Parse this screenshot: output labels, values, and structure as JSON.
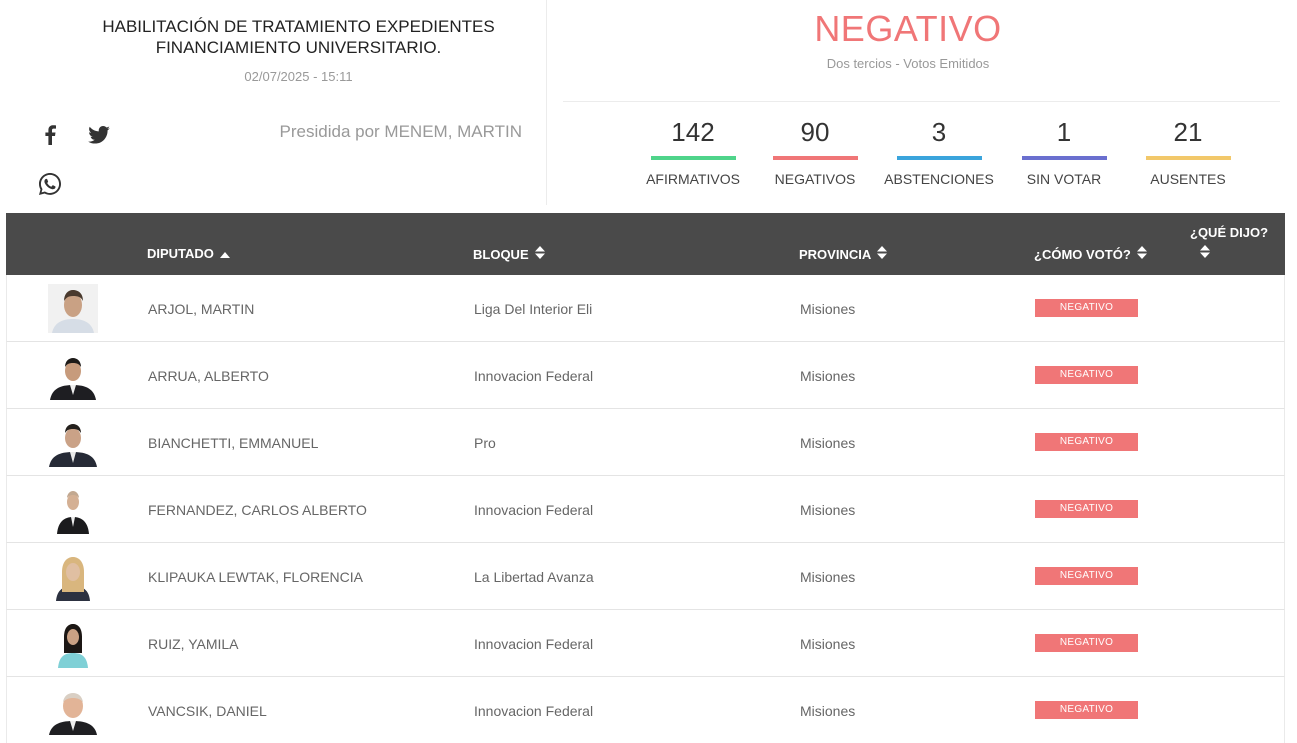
{
  "vote": {
    "title_line1": "HABILITACIÓN DE TRATAMIENTO EXPEDIENTES",
    "title_line2": "FINANCIAMIENTO UNIVERSITARIO.",
    "date": "02/07/2025 - 15:11",
    "presidida": "Presidida por MENEM, MARTIN",
    "result": "NEGATIVO",
    "result_subtitle": "Dos tercios - Votos Emitidos"
  },
  "stats": [
    {
      "value": "142",
      "label": "AFIRMATIVOS",
      "color": "#4fd48a"
    },
    {
      "value": "90",
      "label": "NEGATIVOS",
      "color": "#f07677"
    },
    {
      "value": "3",
      "label": "ABSTENCIONES",
      "color": "#3aa4dc"
    },
    {
      "value": "1",
      "label": "SIN VOTAR",
      "color": "#6a6fcf"
    },
    {
      "value": "21",
      "label": "AUSENTES",
      "color": "#f2c86a"
    }
  ],
  "icons": {
    "facebook": "facebook-icon",
    "twitter": "twitter-icon",
    "whatsapp": "whatsapp-icon"
  },
  "table": {
    "headers": {
      "diputado": "DIPUTADO",
      "bloque": "BLOQUE",
      "provincia": "PROVINCIA",
      "voto": "¿CÓMO VOTÓ?",
      "dijo": "¿QUÉ DIJO?"
    },
    "rows": [
      {
        "name": "ARJOL, MARTIN",
        "bloque": "Liga Del Interior Eli",
        "provincia": "Misiones",
        "voto": "NEGATIVO"
      },
      {
        "name": "ARRUA, ALBERTO",
        "bloque": "Innovacion Federal",
        "provincia": "Misiones",
        "voto": "NEGATIVO"
      },
      {
        "name": "BIANCHETTI, EMMANUEL",
        "bloque": "Pro",
        "provincia": "Misiones",
        "voto": "NEGATIVO"
      },
      {
        "name": "FERNANDEZ, CARLOS ALBERTO",
        "bloque": "Innovacion Federal",
        "provincia": "Misiones",
        "voto": "NEGATIVO"
      },
      {
        "name": "KLIPAUKA LEWTAK, FLORENCIA",
        "bloque": "La Libertad Avanza",
        "provincia": "Misiones",
        "voto": "NEGATIVO"
      },
      {
        "name": "RUIZ, YAMILA",
        "bloque": "Innovacion Federal",
        "provincia": "Misiones",
        "voto": "NEGATIVO"
      },
      {
        "name": "VANCSIK, DANIEL",
        "bloque": "Innovacion Federal",
        "provincia": "Misiones",
        "voto": "NEGATIVO"
      }
    ]
  }
}
